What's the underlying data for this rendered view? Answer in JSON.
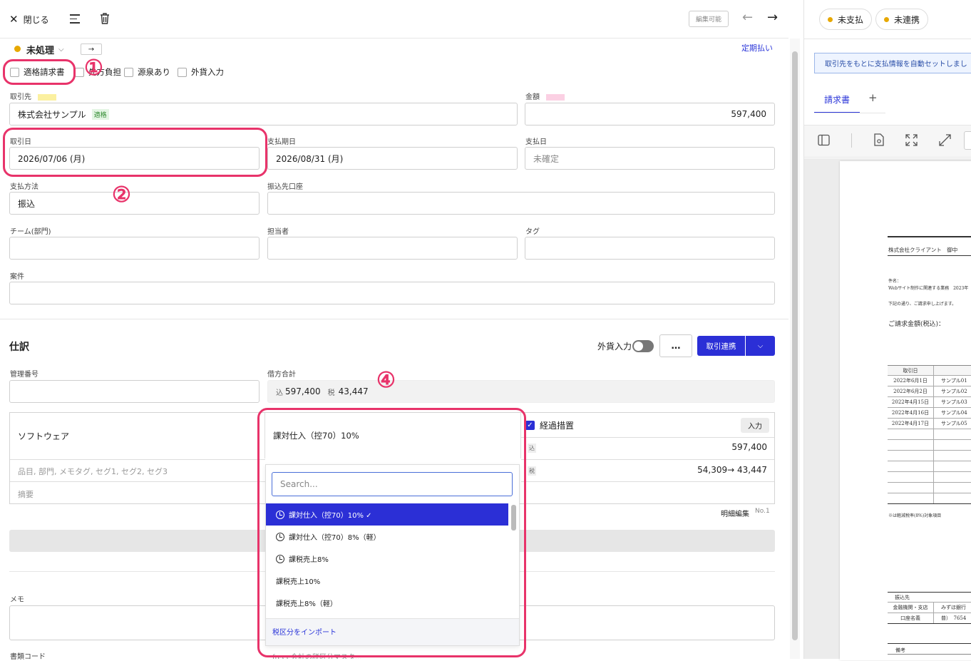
{
  "toolbar": {
    "close_label": "閉じる",
    "editable_badge": "編集可能"
  },
  "status": {
    "label": "未処理",
    "recurring": "定期払い",
    "color": "#e7a800"
  },
  "checks": [
    {
      "label": "適格請求書"
    },
    {
      "label": "先方負担"
    },
    {
      "label": "源泉あり"
    },
    {
      "label": "外貨入力"
    }
  ],
  "form": {
    "partner_label": "取引先",
    "partner_value": "株式会社サンプル",
    "partner_badge": "適格",
    "amount_label": "金額",
    "amount_value": "597,400",
    "txn_date_label": "取引日",
    "txn_date_value": "2026/07/06 (月)",
    "due_date_label": "支払期日",
    "due_date_value": "2026/08/31 (月)",
    "pay_date_label": "支払日",
    "pay_date_placeholder": "未確定",
    "method_label": "支払方法",
    "method_value": "振込",
    "account_label": "振込先口座",
    "team_label": "チーム(部門)",
    "person_label": "担当者",
    "tag_label": "タグ",
    "case_label": "案件"
  },
  "journal": {
    "title": "仕訳",
    "fx_label": "外貨入力",
    "more": "…",
    "link_button": "取引連携",
    "mgmt_label": "管理番号",
    "debit_label": "借方合計",
    "debit_incl_prefix": "込",
    "debit_incl": "597,400",
    "debit_tax_prefix": "税",
    "debit_tax": "43,447",
    "account": "ソフトウェア",
    "segments_placeholder": "品目, 部門, メモタグ, セグ1, セグ2, セグ3",
    "summary_placeholder": "摘要",
    "tax_selected": "課対仕入（控70）10%",
    "transitional": "経過措置",
    "input_btn": "入力",
    "amount_prefix": "込",
    "amount": "597,400",
    "tax_prefix": "税",
    "tax_amount": "54,309→ 43,447",
    "detail_edit": "明細編集",
    "line_no": "No.1",
    "memo_label": "メモ",
    "doc_code_label": "書類コード"
  },
  "dropdown": {
    "search_placeholder": "Search...",
    "options": [
      {
        "label": "課対仕入（控70）10% ✓",
        "icon": "clock-icon"
      },
      {
        "label": "課対仕入（控70）8%（軽）",
        "icon": "clock-icon"
      },
      {
        "label": "課税売上8%",
        "icon": "clock-icon"
      },
      {
        "label": "課税売上10%"
      },
      {
        "label": "課税売上8%（軽）"
      }
    ],
    "import_link": "税区分をインポート",
    "footer_cut": "freee会計の税区分マスタ..."
  },
  "annotations": {
    "n1": "①",
    "n2": "②",
    "n4": "④"
  },
  "right": {
    "chip1": "未支払",
    "chip2": "未連携",
    "info": "取引先をもとに支払情報を自動セットしまし",
    "tab": "請求書",
    "tab_add": "+",
    "pdf": {
      "client": "株式会社クライアント　御中",
      "subject_label": "件名：",
      "subject": "Webサイト制作に関連する業務　2023年",
      "note": "下記の通り、ご請求申し上げます。",
      "total_label": "ご請求金額(税込)：",
      "table_header": "取引日",
      "rows": [
        {
          "d": "2022年6月1日",
          "n": "サンプル01"
        },
        {
          "d": "2022年6月2日",
          "n": "サンプル02"
        },
        {
          "d": "2022年4月15日",
          "n": "サンプル03"
        },
        {
          "d": "2022年4月16日",
          "n": "サンプル04"
        },
        {
          "d": "2022年4月17日",
          "n": "サンプル05"
        }
      ],
      "reduced_note": "※は軽減税率(8%)対象項目",
      "bank_title": "振込先",
      "bank_label": "金融機関・支店",
      "bank_value": "みずほ銀行",
      "acct_label": "口座名義",
      "acct_value": "普）　7654",
      "remarks": "備考"
    }
  }
}
